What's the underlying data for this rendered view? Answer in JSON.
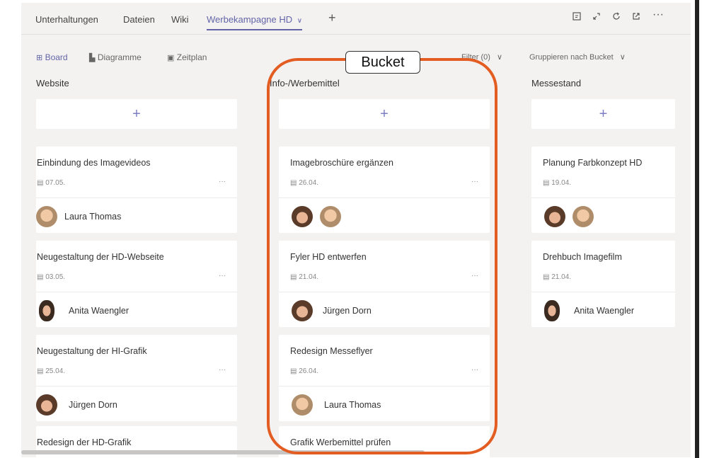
{
  "tabs": [
    {
      "label": "Unterhaltungen"
    },
    {
      "label": "Dateien"
    },
    {
      "label": "Wiki"
    },
    {
      "label": "Werbekampagne HD",
      "chevron": "∨",
      "active": true
    }
  ],
  "add_tab_label": "+",
  "header_icons": [
    "expand-icon",
    "popout-icon",
    "refresh-icon",
    "open-external-icon",
    "more-icon"
  ],
  "views": [
    {
      "label": "Board",
      "icon": "board-icon",
      "active": true
    },
    {
      "label": "Diagramme",
      "icon": "chart-icon"
    },
    {
      "label": "Zeitplan",
      "icon": "calendar-icon"
    }
  ],
  "filter_label": "Filter (0)",
  "group_label": "Gruppieren nach Bucket",
  "annotation_label": "Bucket",
  "accent_color": "#6264a7",
  "annotation_color": "#e35d22",
  "buckets": [
    {
      "name": "Website",
      "add": "+",
      "cards": [
        {
          "title": "Einbindung des Imagevideos",
          "date": "07.05.",
          "people": [
            "Laura Thomas"
          ]
        },
        {
          "title": "Neugestaltung der HD-Webseite",
          "date": "03.05.",
          "people": [
            "Anita Waengler"
          ]
        },
        {
          "title": "Neugestaltung der HI-Grafik",
          "date": "25.04.",
          "people": [
            "Jürgen Dorn"
          ]
        },
        {
          "title": "Redesign der HD-Grafik"
        }
      ]
    },
    {
      "name": "Info-/Werbemittel",
      "add": "+",
      "cards": [
        {
          "title": "Imagebroschüre ergänzen",
          "date": "26.04.",
          "avatars": 2
        },
        {
          "title": "Fyler HD entwerfen",
          "date": "21.04.",
          "people": [
            "Jürgen Dorn"
          ]
        },
        {
          "title": "Redesign Messeflyer",
          "date": "26.04.",
          "people": [
            "Laura Thomas"
          ]
        },
        {
          "title": "Grafik Werbemittel prüfen"
        }
      ]
    },
    {
      "name": "Messestand",
      "add": "+",
      "cards": [
        {
          "title": "Planung Farbkonzept HD",
          "date": "19.04.",
          "avatars": 2
        },
        {
          "title": "Drehbuch Imagefilm",
          "date": "21.04.",
          "people": [
            "Anita Waengler"
          ]
        }
      ]
    }
  ],
  "card_more": "···",
  "date_icon": "▤"
}
